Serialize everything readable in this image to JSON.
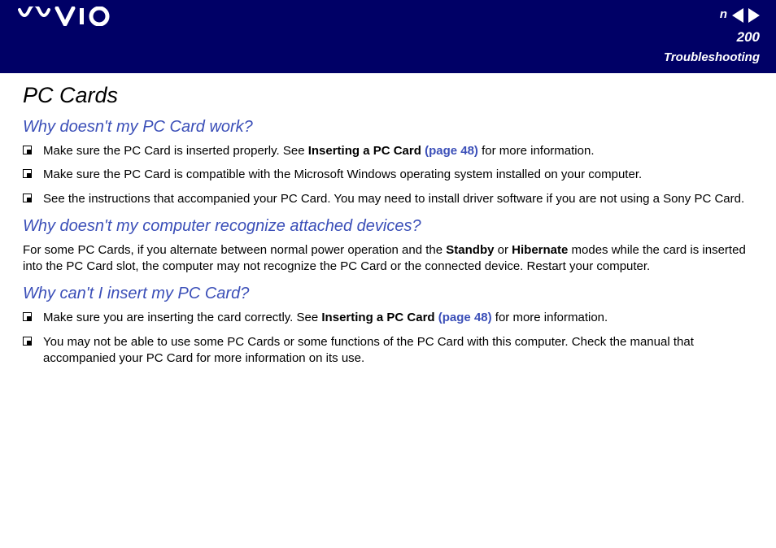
{
  "header": {
    "page_number": "200",
    "section": "Troubleshooting",
    "n_label": "n"
  },
  "content": {
    "title": "PC Cards",
    "q1": {
      "heading": "Why doesn't my PC Card work?",
      "bullets": [
        {
          "pre": "Make sure the PC Card is inserted properly. See ",
          "bold": "Inserting a PC Card ",
          "link": "(page 48)",
          "post": " for more information."
        },
        {
          "pre": "Make sure the PC Card is compatible with the Microsoft Windows operating system installed on your computer.",
          "bold": "",
          "link": "",
          "post": ""
        },
        {
          "pre": "See the instructions that accompanied your PC Card. You may need to install driver software if you are not using a Sony PC Card.",
          "bold": "",
          "link": "",
          "post": ""
        }
      ]
    },
    "q2": {
      "heading": "Why doesn't my computer recognize attached devices?",
      "para_pre": "For some PC Cards, if you alternate between normal power operation and the ",
      "para_bold1": "Standby",
      "para_mid": " or ",
      "para_bold2": "Hibernate",
      "para_post": " modes while the card is inserted into the PC Card slot, the computer may not recognize the PC Card or the connected device. Restart your computer."
    },
    "q3": {
      "heading": "Why can't I insert my PC Card?",
      "bullets": [
        {
          "pre": "Make sure you are inserting the card correctly. See ",
          "bold": "Inserting a PC Card ",
          "link": "(page 48)",
          "post": " for more information."
        },
        {
          "pre": "You may not be able to use some PC Cards or some functions of the PC Card with this computer. Check the manual that accompanied your PC Card for more information on its use.",
          "bold": "",
          "link": "",
          "post": ""
        }
      ]
    }
  }
}
